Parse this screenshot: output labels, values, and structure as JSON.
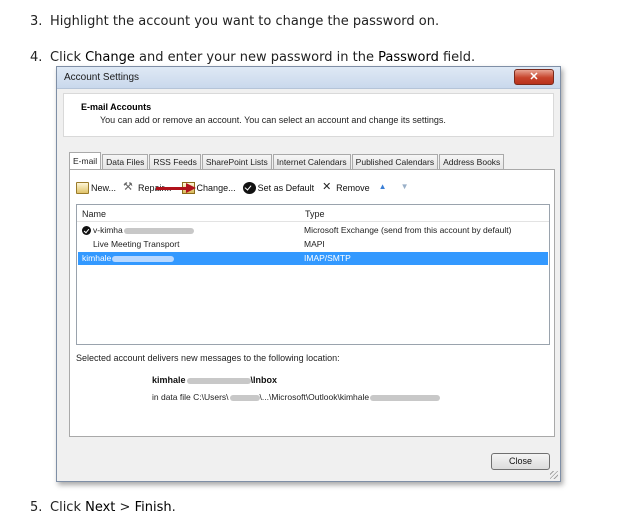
{
  "steps": {
    "step3": {
      "num": "3.",
      "text": "Highlight the account you want to change the password on."
    },
    "step4": {
      "num": "4.",
      "pre": "Click ",
      "b1": "Change",
      "mid": " and enter your new password in the ",
      "b2": "Password",
      "post": " field."
    },
    "step5": {
      "num": "5.",
      "pre": "Click ",
      "b1": "Next",
      "mid": " > ",
      "b2": "Finish",
      "post": "."
    }
  },
  "dialog": {
    "title": "Account Settings",
    "close_glyph": "✕",
    "header": {
      "title": "E-mail Accounts",
      "subtitle": "You can add or remove an account. You can select an account and change its settings."
    },
    "tabs": [
      "E-mail",
      "Data Files",
      "RSS Feeds",
      "SharePoint Lists",
      "Internet Calendars",
      "Published Calendars",
      "Address Books"
    ],
    "active_tab": "E-mail",
    "toolbar": {
      "new": "New...",
      "repair": "Repair...",
      "change": "Change...",
      "set_default": "Set as Default",
      "remove": "Remove"
    },
    "list": {
      "col_name": "Name",
      "col_type": "Type",
      "rows": [
        {
          "name": "v-kimha",
          "type": "Microsoft Exchange (send from this account by default)",
          "default": true,
          "selected": false
        },
        {
          "name": "Live Meeting Transport",
          "type": "MAPI",
          "default": false,
          "selected": false
        },
        {
          "name": "kimhale",
          "type": "IMAP/SMTP",
          "default": false,
          "selected": true
        }
      ]
    },
    "deliver_text": "Selected account delivers new messages to the following location:",
    "location": {
      "account": "kimhale",
      "folder": "\\Inbox"
    },
    "datafile": {
      "prefix": "in data file C:\\Users\\",
      "middle": "\\...\\Microsoft\\Outlook\\kimhale"
    },
    "close_button": "Close"
  },
  "colors": {
    "selection": "#3399ff",
    "arrow": "#b0121b",
    "titlebar": "#c9d8ec"
  },
  "icons": [
    "new-mail-icon",
    "repair-icon",
    "change-icon",
    "check-icon",
    "remove-icon",
    "move-up-icon",
    "move-down-icon"
  ]
}
